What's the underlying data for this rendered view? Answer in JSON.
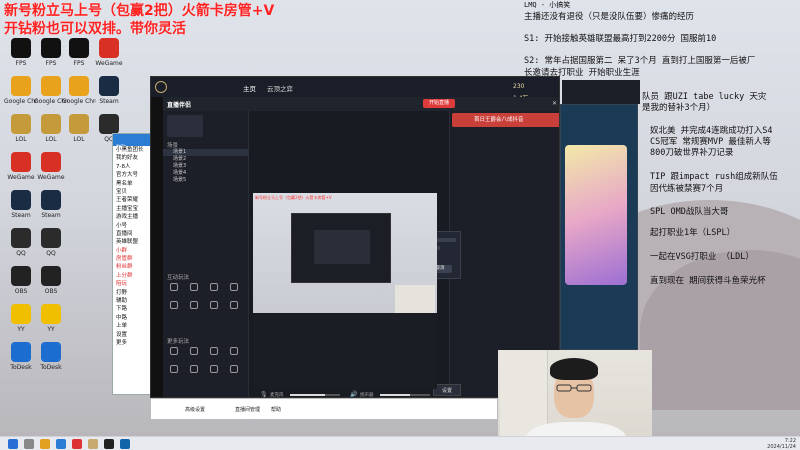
{
  "overlay": {
    "line1": "新号粉立马上号（包赢2把）火箭卡房管+V",
    "line2": "开钻粉也可以双排。带你灵活"
  },
  "desktop_icons": [
    {
      "label": "FPS",
      "color": "#111"
    },
    {
      "label": "Google Chrome",
      "color": "#e8a21c"
    },
    {
      "label": "LOL",
      "color": "#c49a3a"
    },
    {
      "label": "WeGame",
      "color": "#d93025"
    },
    {
      "label": "Steam",
      "color": "#1a2b44"
    },
    {
      "label": "QQ",
      "color": "#2b2b2b"
    },
    {
      "label": "OBS",
      "color": "#222"
    },
    {
      "label": "YY",
      "color": "#f0c000"
    },
    {
      "label": "ToDesk",
      "color": "#1c6dd0"
    }
  ],
  "chat_window": {
    "title": "群聊",
    "rows": [
      "小黑鱼团长",
      "我的好友",
      "7-8人",
      "官方大号",
      "黑名单",
      "宝贝",
      "王者荣耀",
      "主播宝宝",
      "游戏主播",
      "小号",
      "直播间",
      "英雄联盟",
      "小群",
      "房管群",
      "粉丝群",
      "上分群",
      "陪玩",
      "打野",
      "辅助",
      "下路",
      "中路",
      "上单",
      "设置",
      "更多"
    ]
  },
  "client": {
    "tabs": [
      "主页",
      "云顶之弈"
    ],
    "coins": "230",
    "balance": "1.4万",
    "app_name": "直播伴侣",
    "live_button": "开始直播",
    "promo": "首日王爵会八成抖音",
    "scene_section": "场景",
    "scenes": [
      "场景1",
      "场景2",
      "场景3",
      "场景4",
      "场景5"
    ],
    "tools_section": "互动玩法",
    "more_tools": "更多玩法",
    "dialog_confirm": "确认",
    "dialog_cancel": "取消",
    "audio_mic": "麦克风",
    "audio_speaker": "扬声器",
    "settings_button": "设置"
  },
  "strip": [
    "高级设置",
    "直播间管理",
    "帮助"
  ],
  "right_text": {
    "header": "LMQ - 小搞笑",
    "line1": "主播还没有退役（只是没队伍要）惨痛的经历",
    "s1": "S1:  开始接触英雄联盟最高打到2200分 国服前10",
    "s2a": "S2:  常年占据国服第二 呆了3个月 直到打上国服第一后被厂",
    "s2b": "     长邀请去打职业 开始职业生涯",
    "l3": "队员 跟UZI tabe lucky 天灾",
    "l4": "是我的替补3个月）",
    "l5": "奴北美 并完成4连跳成功打入S4",
    "l6": "CS冠军 常规赛MVP 最佳新人等",
    "l7": "800刀破世界补刀记录",
    "l8": "TIP 跟impact rush组成新队伍",
    "l9": "因代练被禁赛7个月",
    "l10": "SPL OMD战队当大哥",
    "l11": "起打职业1年（LSPL）",
    "l12": "一起在VSG打职业  （LDL）",
    "l13": "直到现在 期间获得斗鱼荣光杯"
  },
  "taskbar": {
    "time": "7:22",
    "date": "2024/11/24"
  }
}
